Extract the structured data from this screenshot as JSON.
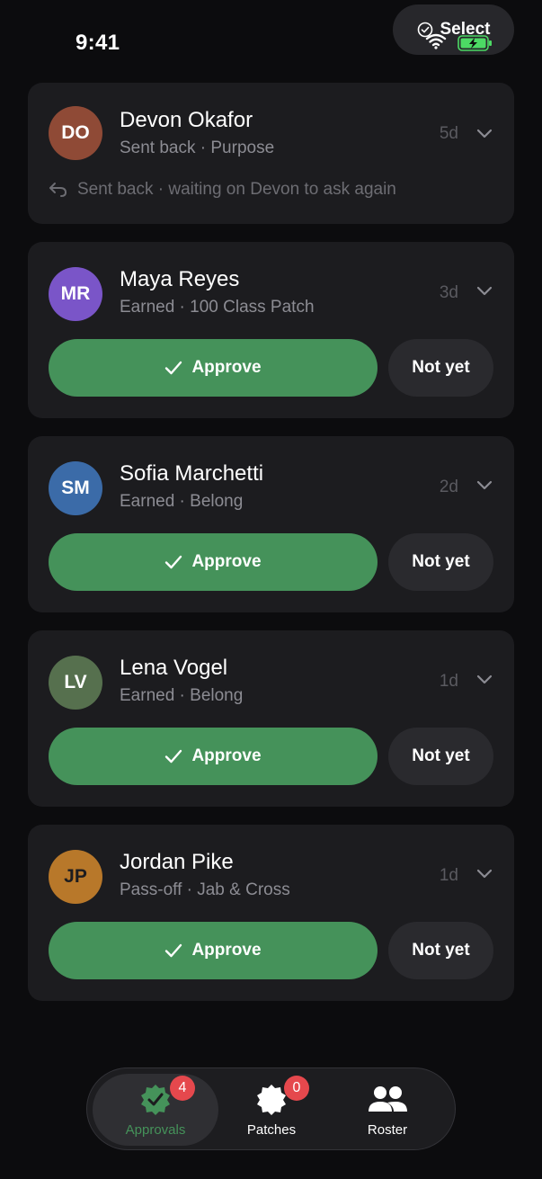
{
  "status_bar": {
    "time": "9:41"
  },
  "header": {
    "select_label": "Select"
  },
  "colors": {
    "accent": "#45925a",
    "badge": "#e5484d",
    "card": "#1c1c1f"
  },
  "cards": [
    {
      "initials": "DO",
      "avatar_color": "#8f4a36",
      "name": "Devon Okafor",
      "subtitle": "Sent back · Purpose",
      "age": "5d",
      "note": "Sent back · waiting on Devon to ask again"
    },
    {
      "initials": "MR",
      "avatar_color": "#7a55c8",
      "name": "Maya Reyes",
      "subtitle": "Earned · 100 Class Patch",
      "age": "3d",
      "approve_label": "Approve",
      "notyet_label": "Not yet"
    },
    {
      "initials": "SM",
      "avatar_color": "#3b6ba8",
      "name": "Sofia Marchetti",
      "subtitle": "Earned · Belong",
      "age": "2d",
      "approve_label": "Approve",
      "notyet_label": "Not yet"
    },
    {
      "initials": "LV",
      "avatar_color": "#56704e",
      "name": "Lena Vogel",
      "subtitle": "Earned · Belong",
      "age": "1d",
      "approve_label": "Approve",
      "notyet_label": "Not yet"
    },
    {
      "initials": "JP",
      "avatar_color": "#b8782a",
      "name": "Jordan Pike",
      "subtitle": "Pass-off · Jab & Cross",
      "age": "1d",
      "approve_label": "Approve",
      "notyet_label": "Not yet"
    }
  ],
  "tabbar": {
    "tabs": [
      {
        "label": "Approvals",
        "badge": "4",
        "icon": "seal-check-icon",
        "active": true
      },
      {
        "label": "Patches",
        "badge": "0",
        "icon": "patch-icon",
        "active": false
      },
      {
        "label": "Roster",
        "icon": "people-icon",
        "active": false
      }
    ]
  }
}
